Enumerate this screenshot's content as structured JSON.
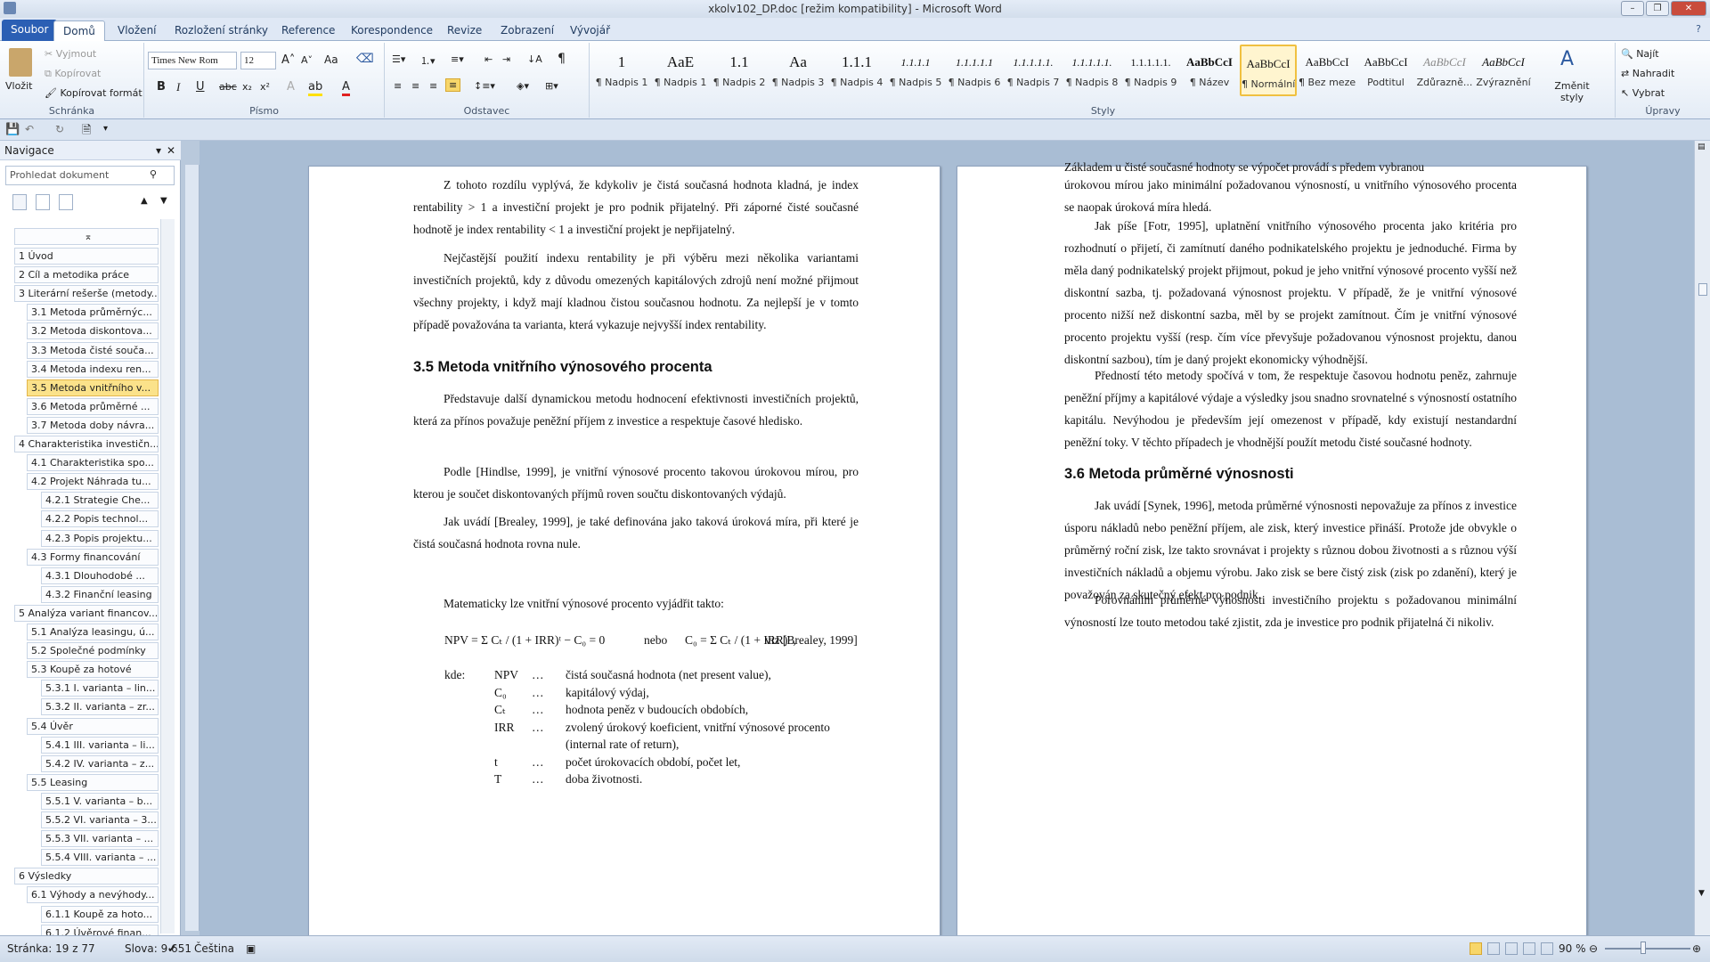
{
  "window": {
    "title": "xkolv102_DP.doc [režim kompatibility] - Microsoft Word"
  },
  "tabs": [
    "Soubor",
    "Domů",
    "Vložení",
    "Rozložení stránky",
    "Reference",
    "Korespondence",
    "Revize",
    "Zobrazení",
    "Vývojář"
  ],
  "ribbon": {
    "clipboard": {
      "label": "Schránka",
      "paste": "Vložit",
      "cut": "Vyjmout",
      "copy": "Kopírovat",
      "format_painter": "Kopírovat formát"
    },
    "font": {
      "label": "Písmo",
      "name": "Times New Rom",
      "size": "12",
      "case": "Aa"
    },
    "paragraph": {
      "label": "Odstavec"
    },
    "styles": {
      "label": "Styly",
      "change_styles": "Změnit styly",
      "items": [
        {
          "preview": "1",
          "name": "¶ Nadpis 1"
        },
        {
          "preview": "AaE",
          "name": "¶ Nadpis 1"
        },
        {
          "preview": "1.1",
          "name": "¶ Nadpis 2"
        },
        {
          "preview": "Aa",
          "name": "¶ Nadpis 3"
        },
        {
          "preview": "1.1.1",
          "name": "¶ Nadpis 4"
        },
        {
          "preview": "1.1.1.1",
          "name": "¶ Nadpis 5"
        },
        {
          "preview": "1.1.1.1.1",
          "name": "¶ Nadpis 6"
        },
        {
          "preview": "1.1.1.1.1.",
          "name": "¶ Nadpis 7"
        },
        {
          "preview": "1.1.1.1.1.",
          "name": "¶ Nadpis 8"
        },
        {
          "preview": "1.1.1.1.1.",
          "name": "¶ Nadpis 9"
        },
        {
          "preview": "AaBbCcI",
          "name": "¶ Název"
        },
        {
          "preview": "AaBbCcI",
          "name": "¶ Normální"
        },
        {
          "preview": "AaBbCcI",
          "name": "¶ Bez mezer"
        },
        {
          "preview": "AaBbCcI",
          "name": "Podtitul"
        },
        {
          "preview": "AaBbCcI",
          "name": "Zdůrazně..."
        },
        {
          "preview": "AaBbCcI",
          "name": "Zvýraznění"
        }
      ]
    },
    "editing": {
      "label": "Úpravy",
      "find": "Najít",
      "replace": "Nahradit",
      "select": "Vybrat"
    }
  },
  "nav": {
    "title": "Navigace",
    "search_placeholder": "Prohledat dokument",
    "items": [
      {
        "label": "1 Úvod",
        "level": 1
      },
      {
        "label": "2 Cíl a metodika práce",
        "level": 1
      },
      {
        "label": "3 Literární rešerše (metody...",
        "level": 1
      },
      {
        "label": "3.1 Metoda průměrnýc...",
        "level": 2
      },
      {
        "label": "3.2 Metoda diskontova...",
        "level": 2
      },
      {
        "label": "3.3 Metoda čisté souča...",
        "level": 2
      },
      {
        "label": "3.4 Metoda indexu ren...",
        "level": 2
      },
      {
        "label": "3.5 Metoda vnitřního v...",
        "level": 2,
        "selected": true
      },
      {
        "label": "3.6 Metoda průměrné ...",
        "level": 2
      },
      {
        "label": "3.7 Metoda doby návra...",
        "level": 2
      },
      {
        "label": "4 Charakteristika investičn...",
        "level": 1
      },
      {
        "label": "4.1 Charakteristika spo...",
        "level": 2
      },
      {
        "label": "4.2 Projekt Náhrada tu...",
        "level": 2
      },
      {
        "label": "4.2.1 Strategie Che...",
        "level": 3
      },
      {
        "label": "4.2.2 Popis technol...",
        "level": 3
      },
      {
        "label": "4.2.3 Popis projektu...",
        "level": 3
      },
      {
        "label": "4.3 Formy financování",
        "level": 2
      },
      {
        "label": "4.3.1 Dlouhodobé ...",
        "level": 3
      },
      {
        "label": "4.3.2 Finanční leasing",
        "level": 3
      },
      {
        "label": "5 Analýza variant financov...",
        "level": 1
      },
      {
        "label": "5.1 Analýza leasingu, ú...",
        "level": 2
      },
      {
        "label": "5.2 Společné podmínky",
        "level": 2
      },
      {
        "label": "5.3 Koupě za hotové",
        "level": 2
      },
      {
        "label": "5.3.1 I. varianta – lin...",
        "level": 3
      },
      {
        "label": "5.3.2 II. varianta – zr...",
        "level": 3
      },
      {
        "label": "5.4 Úvěr",
        "level": 2
      },
      {
        "label": "5.4.1 III. varianta – li...",
        "level": 3
      },
      {
        "label": "5.4.2 IV. varianta – z...",
        "level": 3
      },
      {
        "label": "5.5 Leasing",
        "level": 2
      },
      {
        "label": "5.5.1 V. varianta – b...",
        "level": 3
      },
      {
        "label": "5.5.2 VI. varianta – 3...",
        "level": 3
      },
      {
        "label": "5.5.3 VII. varianta – ...",
        "level": 3
      },
      {
        "label": "5.5.4 VIII. varianta – ...",
        "level": 3
      },
      {
        "label": "6 Výsledky",
        "level": 1
      },
      {
        "label": "6.1 Výhody a nevýhody...",
        "level": 2
      },
      {
        "label": "6.1.1 Koupě za hoto...",
        "level": 3
      },
      {
        "label": "6.1.2 Úvěrové finan...",
        "level": 3
      }
    ]
  },
  "page_left": {
    "p1": "Z tohoto rozdílu vyplývá, že kdykoliv je čistá současná hodnota kladná, je index rentability > 1 a investiční projekt je pro podnik přijatelný. Při záporné čisté současné hodnotě je index rentability < 1 a investiční projekt je nepřijatelný.",
    "p2": "Nejčastější použití indexu rentability je při výběru mezi několika variantami investičních projektů, kdy z důvodu omezených kapitálových zdrojů není možné přijmout všechny projekty, i když mají kladnou čistou současnou hodnotu. Za nejlepší je v tomto případě považována ta varianta, která vykazuje nejvyšší index rentability.",
    "heading": "3.5 Metoda vnitřního výnosového procenta",
    "p3": "Představuje další dynamickou metodu hodnocení efektivnosti investičních projektů, která za přínos považuje peněžní příjem z investice a respektuje časové hledisko.",
    "p4": "Podle [Hindlse, 1999], je vnitřní výnosové procento takovou úrokovou mírou, pro kterou je součet diskontovaných příjmů roven součtu diskontovaných výdajů.",
    "p5": "Jak uvádí [Brealey, 1999], je také definována jako taková úroková míra, při které je čistá současná hodnota rovna nule.",
    "p6": "Matematicky lze vnitřní výnosové procento vyjádřit takto:",
    "formula_a": "NPV = Σ Cₜ / (1 + IRR)ᵗ − C₀ = 0",
    "formula_or": "nebo",
    "formula_b": "C₀ = Σ Cₜ / (1 + IRR)ᵗ ,",
    "formula_ref": "viz [Brealey, 1999]",
    "where": "kde:",
    "defs": [
      {
        "sym": "NPV",
        "dots": "…",
        "desc": "čistá současná hodnota (net present value),"
      },
      {
        "sym": "C₀",
        "dots": "…",
        "desc": "kapitálový výdaj,"
      },
      {
        "sym": "Cₜ",
        "dots": "…",
        "desc": "hodnota peněz v budoucích obdobích,"
      },
      {
        "sym": "IRR",
        "dots": "…",
        "desc": "zvolený úrokový koeficient, vnitřní výnosové procento"
      },
      {
        "sym": "",
        "dots": "",
        "desc": "(internal rate of return),"
      },
      {
        "sym": "t",
        "dots": "…",
        "desc": "počet úrokovacích období, počet let,"
      },
      {
        "sym": "T",
        "dots": "…",
        "desc": "doba životnosti."
      }
    ]
  },
  "page_right": {
    "p0a": "Základem u čisté současné hodnoty se výpočet provádí s předem vybranou",
    "p0": "úrokovou mírou jako minimální požadovanou výnosností, u vnitřního výnosového procenta se naopak úroková míra hledá.",
    "p1": "Jak píše [Fotr, 1995], uplatnění vnitřního výnosového procenta jako kritéria pro rozhodnutí o přijetí, či zamítnutí daného podnikatelského projektu je jednoduché. Firma by měla daný podnikatelský projekt přijmout, pokud je jeho vnitřní výnosové procento vyšší než diskontní sazba, tj. požadovaná výnosnost projektu. V případě, že je vnitřní výnosové procento nižší než diskontní sazba, měl by se projekt zamítnout. Čím je vnitřní výnosové procento projektu vyšší (resp. čím více převyšuje požadovanou výnosnost projektu, danou diskontní sazbou), tím je daný projekt ekonomicky výhodnější.",
    "p2": "Předností této metody spočívá v tom, že respektuje časovou hodnotu peněz, zahrnuje peněžní příjmy a kapitálové výdaje a výsledky jsou snadno srovnatelné s výnosností ostatního kapitálu. Nevýhodou je především její omezenost v případě, kdy existují nestandardní peněžní toky. V těchto případech je vhodnější použít metodu čisté současné hodnoty.",
    "heading": "3.6 Metoda průměrné výnosnosti",
    "p3": "Jak uvádí [Synek, 1996], metoda průměrné výnosnosti nepovažuje za přínos z investice úsporu nákladů nebo peněžní příjem, ale zisk, který investice přináší. Protože jde obvykle o průměrný roční zisk, lze takto srovnávat i projekty s různou dobou životnosti a s různou výší investičních nákladů a objemu výrobu. Jako zisk se bere čistý zisk (zisk po zdanění), který je považován za skutečný efekt pro podnik.",
    "p4": "Porovnáním průměrné výnosnosti investičního projektu s požadovanou minimální výnosností lze touto metodou také zjistit, zda je investice pro podnik přijatelná či nikoliv."
  },
  "status": {
    "page": "Stránka: 19 z 77",
    "words": "Slova: 9 651",
    "language": "Čeština",
    "zoom": "90 %"
  }
}
